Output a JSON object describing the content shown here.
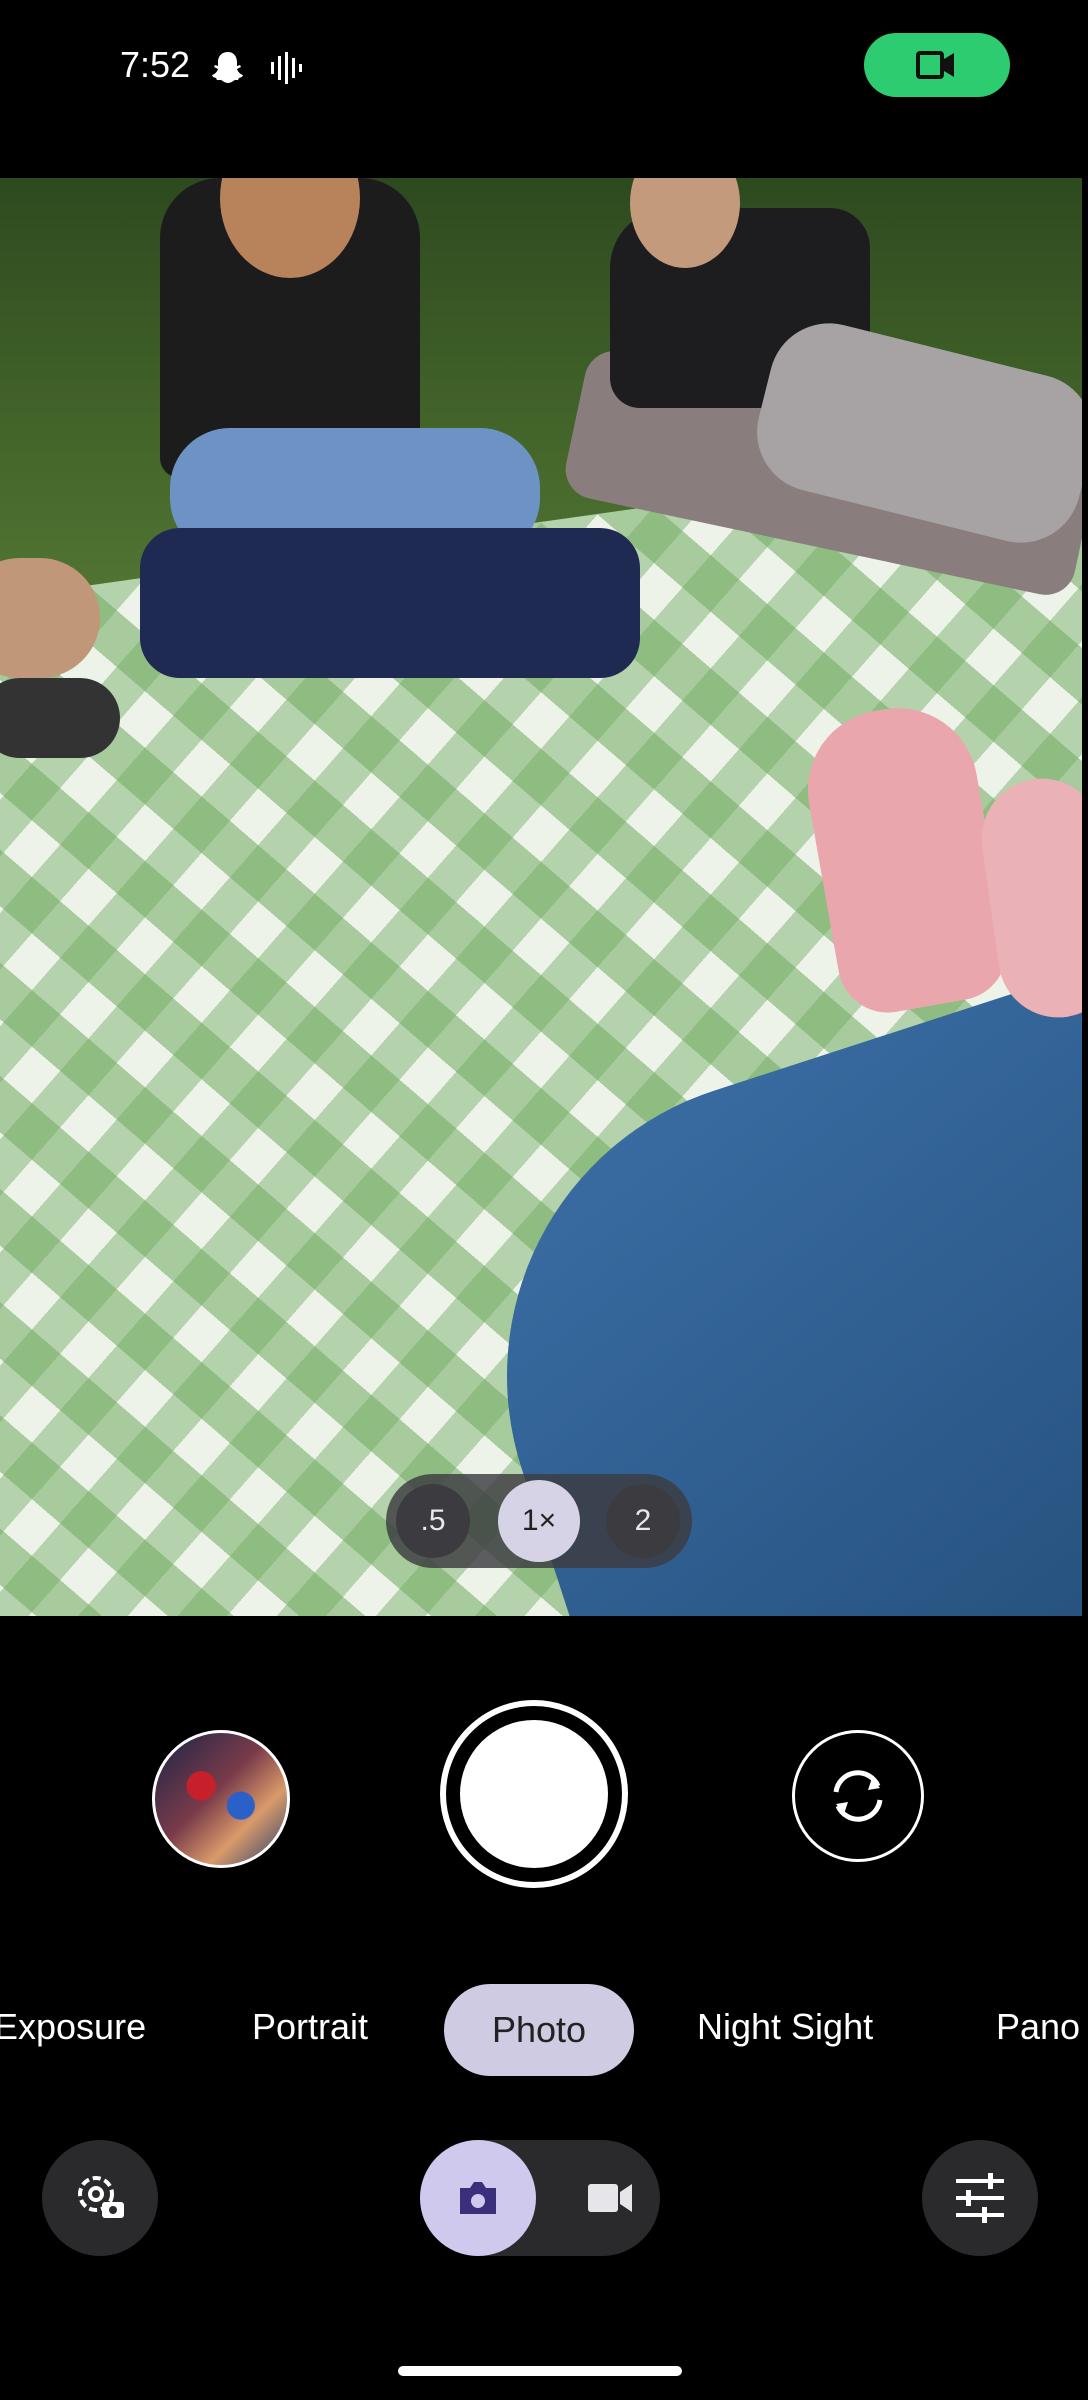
{
  "status_bar": {
    "time": "7:52",
    "icons": [
      "snapchat-icon",
      "sound-wave-icon",
      "screen-record-icon"
    ],
    "record_pill_color": "#2ecc71"
  },
  "zoom": {
    "options": [
      ".5",
      "1×",
      "2"
    ],
    "selected": "1×"
  },
  "modes": {
    "items": [
      "Exposure",
      "Portrait",
      "Photo",
      "Night Sight",
      "Pano"
    ],
    "selected": "Photo"
  },
  "controls": {
    "gallery_icon": "gallery-thumbnail",
    "shutter_icon": "shutter-icon",
    "flip_icon": "switch-camera-icon",
    "settings_icon": "camera-settings-icon",
    "photo_toggle_icon": "camera-icon",
    "video_toggle_icon": "video-camera-icon",
    "adjust_icon": "sliders-icon"
  },
  "colors": {
    "selected_pill": "#cfcbe2",
    "button_bg": "#2a2a2d"
  }
}
